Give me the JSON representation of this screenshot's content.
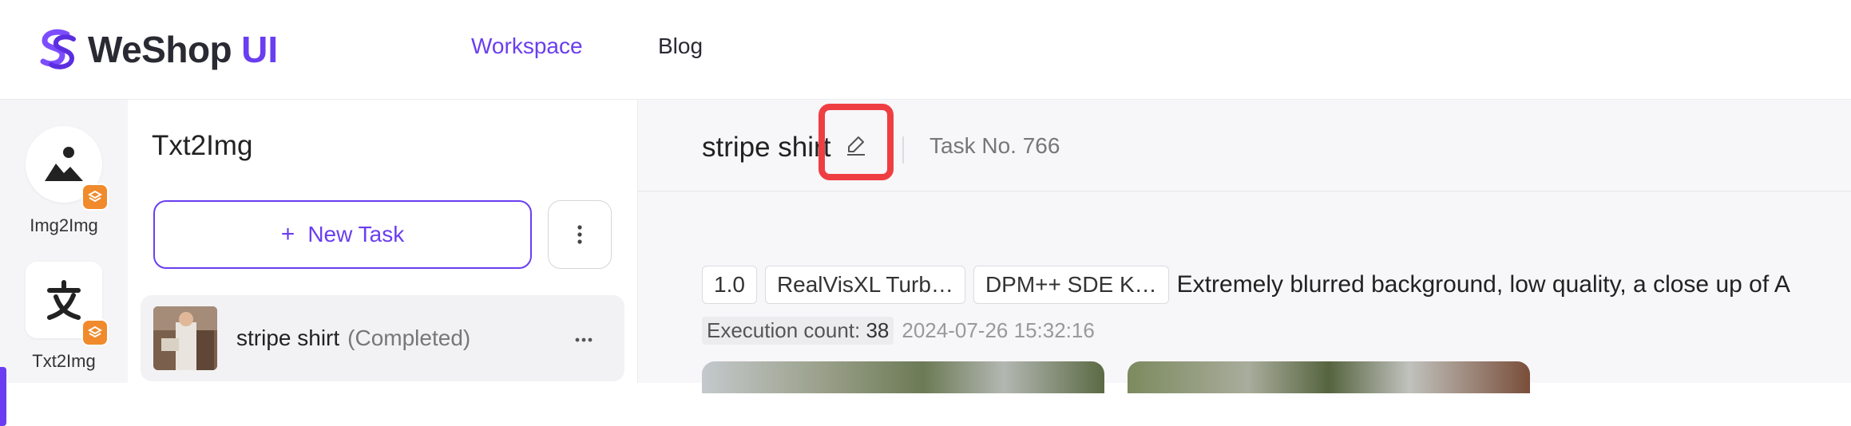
{
  "brand": {
    "name": "WeShop",
    "accent": "UI"
  },
  "nav": {
    "workspace": "Workspace",
    "blog": "Blog"
  },
  "rail": {
    "items": [
      {
        "label": "Img2Img",
        "icon": "image-icon"
      },
      {
        "label": "Txt2Img",
        "icon": "text-translate-icon"
      }
    ],
    "active": "Txt2Img"
  },
  "panel": {
    "title": "Txt2Img",
    "new_task_label": "New Task",
    "tasks": [
      {
        "name": "stripe shirt",
        "status": "(Completed)"
      }
    ]
  },
  "main": {
    "title": "stripe shirt",
    "task_no": "Task No. 766",
    "tags": [
      "1.0",
      "RealVisXL Turb…",
      "DPM++ SDE K…"
    ],
    "prompt": "Extremely blurred background, low quality, a close up of A",
    "execution_label": "Execution count:",
    "execution_count": "38",
    "timestamp": "2024-07-26 15:32:16"
  },
  "colors": {
    "accent": "#6a3ef0",
    "badge": "#f08a2c",
    "highlight": "#ef3e42"
  }
}
